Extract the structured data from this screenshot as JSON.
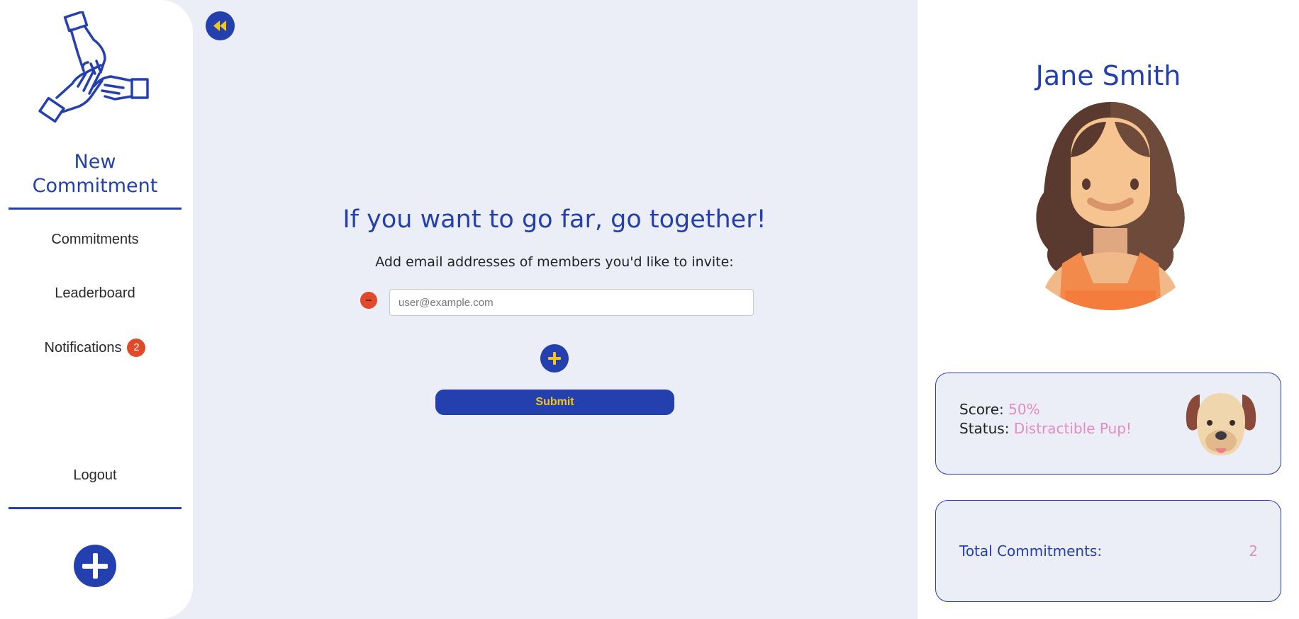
{
  "sidebar": {
    "title_line1": "New",
    "title_line2": "Commitment",
    "items": [
      {
        "label": "Commitments"
      },
      {
        "label": "Leaderboard"
      },
      {
        "label": "Notifications",
        "badge": "2"
      }
    ],
    "logout_label": "Logout",
    "icons": {
      "logo": "hands-together-icon",
      "add": "plus-circle-icon"
    }
  },
  "main": {
    "headline": "If you want to go far, go together!",
    "instruction": "Add email addresses of members you'd like to invite:",
    "email_placeholder": "user@example.com",
    "email_value": "",
    "submit_label": "Submit",
    "icons": {
      "back": "rewind-icon",
      "remove": "minus-circle-icon",
      "add": "plus-icon"
    }
  },
  "profile": {
    "name": "Jane Smith",
    "score_label": "Score:",
    "score_value": "50%",
    "status_label": "Status:",
    "status_value": "Distractible Pup!",
    "total_label": "Total Commitments:",
    "total_value": "2",
    "icons": {
      "avatar": "woman-avatar",
      "status": "dog-icon"
    }
  },
  "colors": {
    "accent": "#2340ae",
    "highlight": "#f2c522",
    "danger": "#e04a2a",
    "pink": "#e38cc4",
    "background": "#eceef7"
  }
}
